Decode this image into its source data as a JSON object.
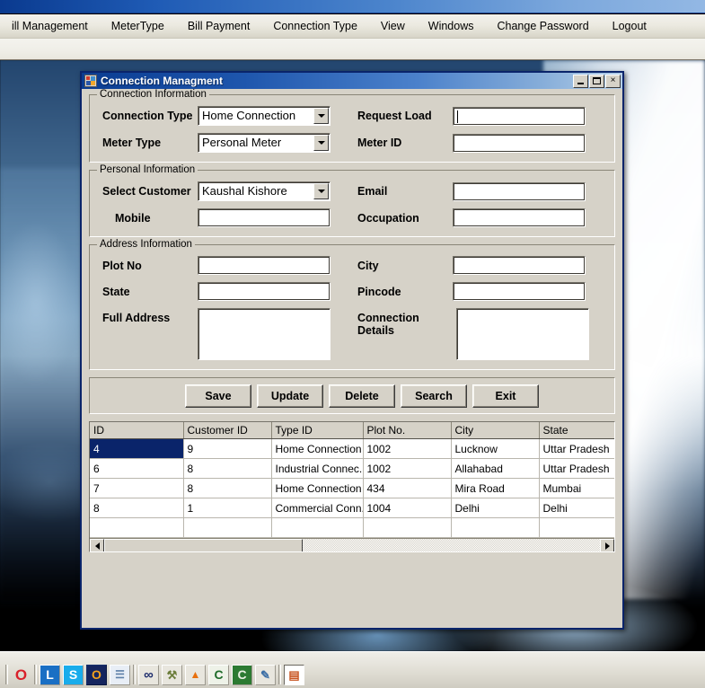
{
  "app": {
    "menubar": [
      {
        "label": "ill Management"
      },
      {
        "label": "MeterType"
      },
      {
        "label": "Bill Payment"
      },
      {
        "label": "Connection Type"
      },
      {
        "label": "View"
      },
      {
        "label": "Windows"
      },
      {
        "label": "Change Password"
      },
      {
        "label": "Logout"
      }
    ]
  },
  "child_window": {
    "title": "Connection Managment",
    "minimize_label": "",
    "maximize_label": "",
    "close_label": "×"
  },
  "connection_information": {
    "legend": "Connection Information",
    "connection_type_label": "Connection Type",
    "connection_type_value": "Home Connection",
    "meter_type_label": "Meter Type",
    "meter_type_value": "Personal Meter",
    "request_load_label": "Request Load",
    "request_load_value": "",
    "meter_id_label": "Meter ID",
    "meter_id_value": ""
  },
  "personal_information": {
    "legend": "Personal Information",
    "select_customer_label": "Select Customer",
    "select_customer_value": "Kaushal Kishore",
    "mobile_label": "Mobile",
    "mobile_value": "",
    "email_label": "Email",
    "email_value": "",
    "occupation_label": "Occupation",
    "occupation_value": ""
  },
  "address_information": {
    "legend": "Address Information",
    "plot_no_label": "Plot No",
    "plot_no_value": "",
    "state_label": "State",
    "state_value": "",
    "full_address_label": "Full Address",
    "full_address_value": "",
    "city_label": "City",
    "city_value": "",
    "pincode_label": "Pincode",
    "pincode_value": "",
    "connection_details_label": "Connection Details",
    "connection_details_value": ""
  },
  "actions": {
    "save": "Save",
    "update": "Update",
    "delete": "Delete",
    "search": "Search",
    "exit": "Exit"
  },
  "grid": {
    "columns": [
      "ID",
      "Customer ID",
      "Type ID",
      "Plot No.",
      "City",
      "State"
    ],
    "rows": [
      {
        "cells": [
          "4",
          "9",
          "Home Connection",
          "1002",
          "Lucknow",
          "Uttar Pradesh"
        ],
        "selected": true
      },
      {
        "cells": [
          "6",
          "8",
          "Industrial Connec...",
          "1002",
          "Allahabad",
          "Uttar Pradesh"
        ],
        "selected": false
      },
      {
        "cells": [
          "7",
          "8",
          "Home Connection",
          "434",
          "Mira Road",
          "Mumbai"
        ],
        "selected": false
      },
      {
        "cells": [
          "8",
          "1",
          "Commercial Conn...",
          "1004",
          "Delhi",
          "Delhi"
        ],
        "selected": false
      },
      {
        "cells": [
          "",
          "",
          "",
          "",
          "",
          ""
        ],
        "selected": false
      }
    ]
  },
  "taskbar": {
    "icons": [
      {
        "name": "opera-icon",
        "glyph": "O",
        "color": "#d9202a",
        "bg": "none",
        "boxed": false
      },
      {
        "name": "lync-icon",
        "glyph": "L",
        "color": "#ffffff",
        "bg": "#1a6fc4",
        "boxed": true
      },
      {
        "name": "skype-icon",
        "glyph": "S",
        "color": "#ffffff",
        "bg": "#19aceb",
        "boxed": true
      },
      {
        "name": "opera-mail-icon",
        "glyph": "O",
        "color": "#f5a21d",
        "bg": "#15255e",
        "boxed": true
      },
      {
        "name": "notepad-icon",
        "glyph": "☰",
        "color": "#5d7fa8",
        "bg": "#e8eef6",
        "boxed": true
      },
      {
        "name": "infinity-icon",
        "glyph": "∞",
        "color": "#1b2a6b",
        "bg": "#e8e6de",
        "boxed": true
      },
      {
        "name": "tools-icon",
        "glyph": "⚒",
        "color": "#6b7d3a",
        "bg": "#e8e6de",
        "boxed": true
      },
      {
        "name": "vlc-icon",
        "glyph": "▲",
        "color": "#e8700d",
        "bg": "#e8e6de",
        "boxed": true
      },
      {
        "name": "turbo-c-icon",
        "glyph": "C",
        "color": "#1d6b28",
        "bg": "#eef2e8",
        "boxed": true
      },
      {
        "name": "turbo-cpp-icon",
        "glyph": "C",
        "color": "#e9f0e2",
        "bg": "#2c7a32",
        "boxed": true
      },
      {
        "name": "paint-icon",
        "glyph": "✒",
        "color": "#3b6ea5",
        "bg": "#e8e6de",
        "boxed": true
      },
      {
        "name": "active-app-icon",
        "glyph": "▤",
        "color": "#c8531f",
        "bg": "#ffffff",
        "boxed": true,
        "active": true
      }
    ]
  }
}
